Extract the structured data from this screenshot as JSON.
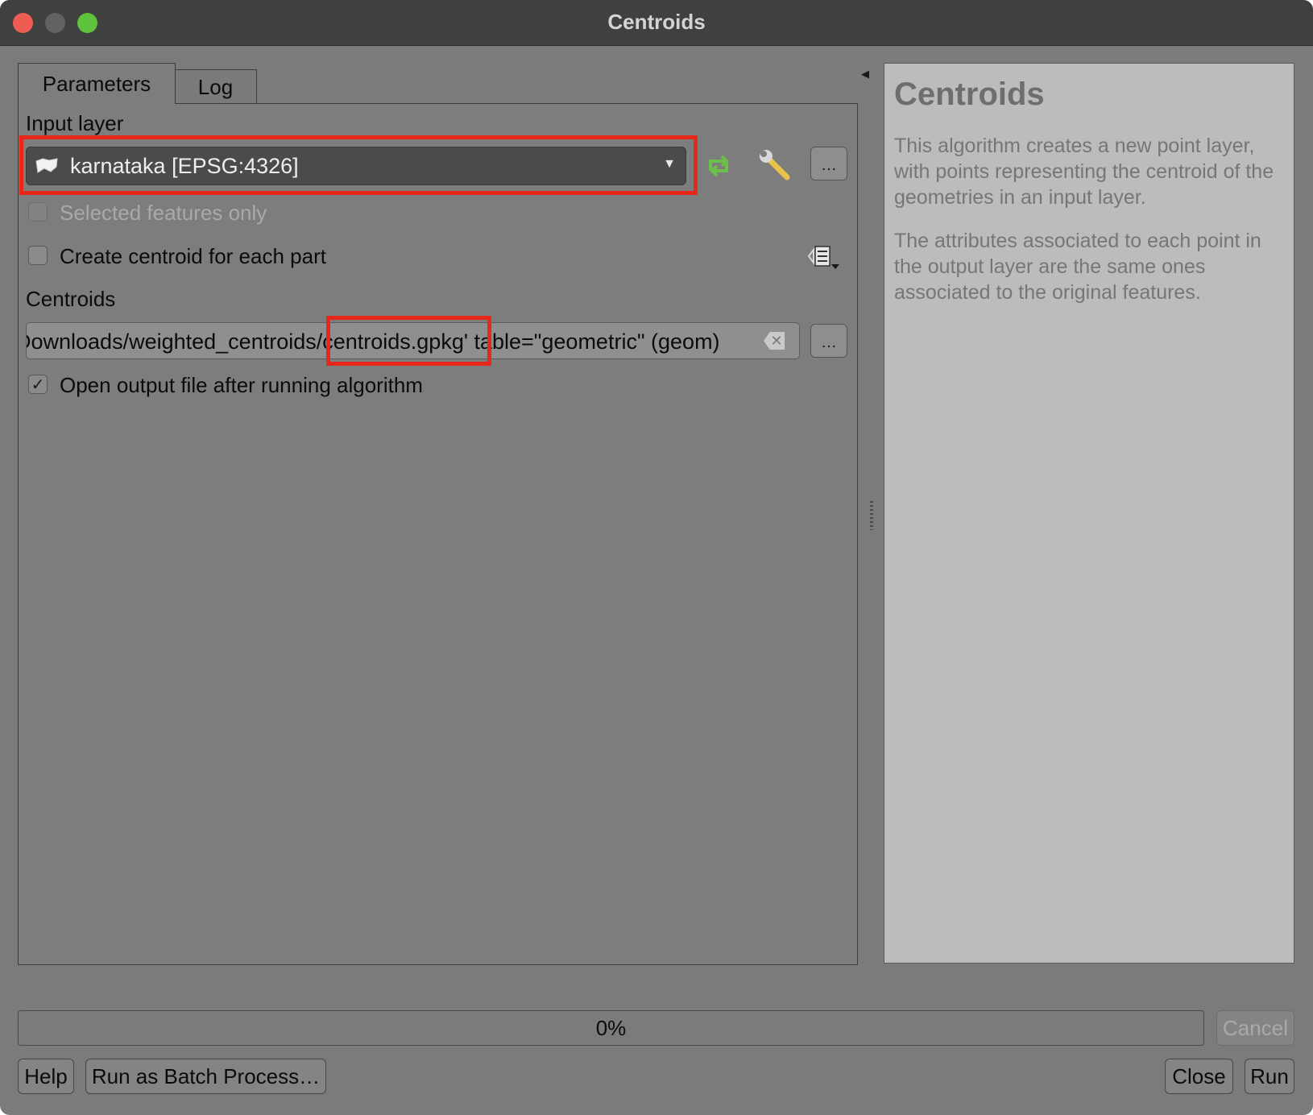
{
  "window": {
    "title": "Centroids"
  },
  "tabs": [
    {
      "label": "Parameters",
      "active": true
    },
    {
      "label": "Log",
      "active": false
    }
  ],
  "params": {
    "input_layer_label": "Input layer",
    "input_layer_value": "karnataka [EPSG:4326]",
    "input_layer_icon": "polygon-layer-icon",
    "selected_only_label": "Selected features only",
    "selected_only_checked": false,
    "selected_only_enabled": false,
    "each_part_label": "Create centroid for each part",
    "each_part_checked": false,
    "centroids_label": "Centroids",
    "centroids_path": "Downloads/weighted_centroids/centroids.gpkg' table=\"geometric\" (geom)",
    "open_output_label": "Open output file after running algorithm",
    "open_output_checked": true,
    "ellipsis": "…"
  },
  "help": {
    "title": "Centroids",
    "paragraph1": "This algorithm creates a new point layer, with points representing the centroid of the geometries in an input layer.",
    "paragraph2": "The attributes associated to each point in the output layer are the same ones associated to the original features."
  },
  "progress": {
    "text": "0%",
    "value": 0
  },
  "buttons": {
    "cancel": "Cancel",
    "help": "Help",
    "batch": "Run as Batch Process…",
    "close": "Close",
    "run": "Run"
  },
  "colors": {
    "highlight": "#e8261a",
    "iterate_icon": "#6cc04a"
  }
}
